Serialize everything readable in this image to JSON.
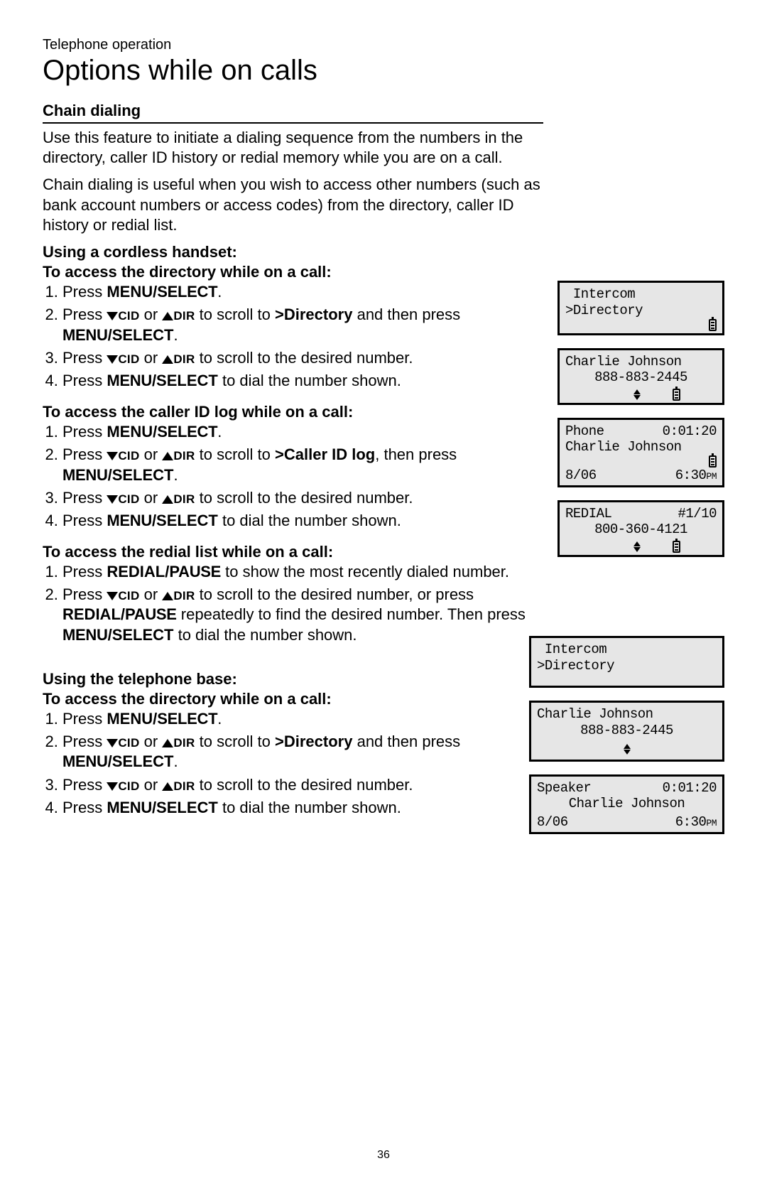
{
  "bookmark": "Telephone operation",
  "title": "Options while on calls",
  "page_number": "36",
  "section": {
    "heading": "Chain dialing",
    "para1": "Use this feature to initiate a dialing sequence from the numbers in the directory, caller ID history or redial memory while you are on a call.",
    "para2": "Chain dialing is useful when you wish to access other numbers (such as bank account numbers or access codes) from the directory, caller ID history or redial list.",
    "handset": {
      "heading": "Using a cordless handset:",
      "dir_h": "To access the directory while on a call:",
      "dir": {
        "s1a": "Press ",
        "s1b": "MENU/",
        "s1c": "SELECT",
        "s1d": ".",
        "s2a": "Press ",
        "s2cid": "CID",
        "s2or": " or ",
        "s2dir": "DIR",
        "s2b": " to scroll to ",
        "s2c": ">Directory",
        "s2d": " and then press ",
        "s2e": "MENU",
        "s2f": "/SELECT",
        "s2g": ".",
        "s3a": "Press ",
        "s3b": " to scroll to the desired number.",
        "s4a": "Press ",
        "s4b": "MENU",
        "s4c": "/SELECT",
        "s4d": " to dial the number shown."
      },
      "cid_h": "To access the caller ID log while on a call:",
      "cid": {
        "s1a": "Press ",
        "s1b": "MENU/",
        "s1c": "SELECT",
        "s1d": ".",
        "s2a": "Press ",
        "s2b": " to scroll to ",
        "s2c": ">Caller ID log",
        "s2d": ", then press ",
        "s2e": "MENU",
        "s2f": "/SELECT",
        "s2g": ".",
        "s3a": "Press ",
        "s3b": " to scroll to the desired number.",
        "s4a": "Press ",
        "s4b": "MENU",
        "s4c": "/SELECT",
        "s4d": " to dial the number shown."
      },
      "redial_h": "To access the redial list while on a call:",
      "redial": {
        "s1a": "Press ",
        "s1b": "REDIAL/",
        "s1c": "PAUSE",
        "s1d": " to show the most recently dialed number.",
        "s2a": "Press ",
        "s2b": " to scroll to the desired number, or press ",
        "s2c": "REDIAL/",
        "s2d": "PAUSE",
        "s2e": " repeatedly to find the desired number. Then press ",
        "s2f": "MENU",
        "s2g": "/SELECT",
        "s2h": " to dial the number shown."
      }
    },
    "base": {
      "heading": "Using the telephone base:",
      "dir_h": "To access the directory while on a call:",
      "dir": {
        "s1a": "Press ",
        "s1b": "MENU/",
        "s1c": "SELECT",
        "s1d": ".",
        "s2a": "Press ",
        "s2b": " to scroll to ",
        "s2c": ">Directory",
        "s2d": " and then press ",
        "s2e": "MENU",
        "s2f": "/SELECT",
        "s2g": ".",
        "s3a": "Press ",
        "s3b": " to scroll to the desired number.",
        "s4a": "Press ",
        "s4b": "MENU",
        "s4c": "/SELECT",
        "s4d": " to dial the number shown."
      }
    }
  },
  "lcd": {
    "cid": "CID",
    "dir": "DIR",
    "s1": {
      "l1": " Intercom",
      "l2": ">Directory"
    },
    "s2": {
      "name": "Charlie Johnson",
      "num": "888-883-2445"
    },
    "s3": {
      "l1a": "Phone",
      "l1b": "0:01:20",
      "l2": "Charlie Johnson",
      "date": "8/06",
      "time": "6:30",
      "pm": "PM"
    },
    "s4": {
      "l1a": "REDIAL",
      "l1b": "#1/10",
      "num": "800-360-4121"
    },
    "b1": {
      "l1": " Intercom",
      "l2": ">Directory"
    },
    "b2": {
      "name": "Charlie Johnson",
      "num": "888-883-2445"
    },
    "b3": {
      "l1a": "Speaker",
      "l1b": "0:01:20",
      "l2": "Charlie Johnson",
      "date": "8/06",
      "time": "6:30",
      "pm": "PM"
    }
  }
}
